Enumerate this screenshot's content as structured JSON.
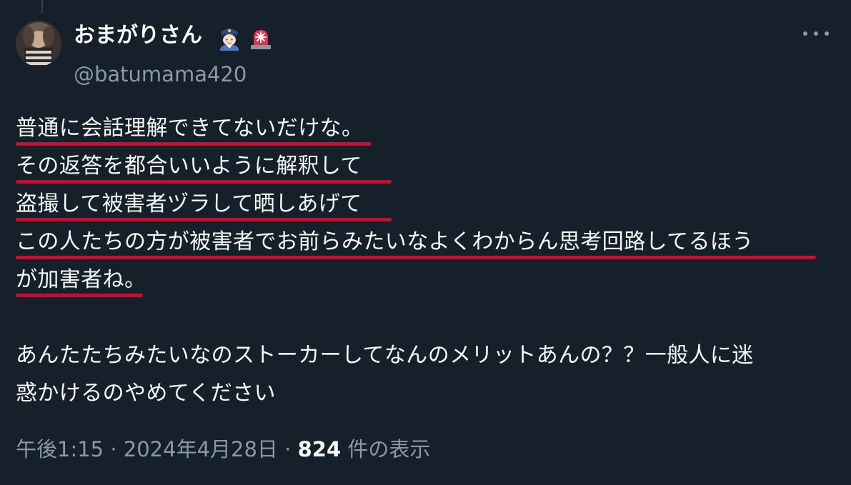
{
  "tweet": {
    "display_name": "おまがりさん",
    "handle": "@batumama420",
    "badges": [
      "police-officer-emoji",
      "police-siren-emoji"
    ],
    "body_lines": [
      "普通に会話理解できてないだけな。",
      "その返答を都合いいように解釈して",
      "盗撮して被害者ヅラして晒しあげて",
      "この人たちの方が被害者でお前らみたいなよくわからん思考回路してるほう",
      "が加害者ね。",
      "",
      "あんたたちみたいなのストーカーしてなんのメリットあんの？？一般人に迷",
      "惑かけるのやめてください"
    ],
    "time": "午後1:15",
    "separator": "·",
    "date": "2024年4月28日",
    "views_count": "824",
    "views_label": "件の表示"
  },
  "colors": {
    "background": "#15202b",
    "text_primary": "#f7f9f9",
    "text_secondary": "#8b98a5",
    "underline_highlight": "#c8102e"
  },
  "icons": {
    "more": "more-horizontal-icon"
  }
}
